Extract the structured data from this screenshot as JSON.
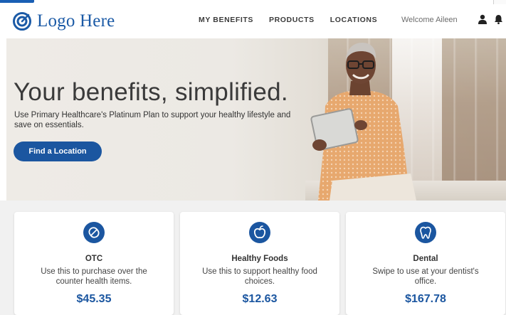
{
  "header": {
    "logo_text": "Logo Here",
    "nav": [
      {
        "label": "MY BENEFITS"
      },
      {
        "label": "PRODUCTS"
      },
      {
        "label": "LOCATIONS"
      }
    ],
    "welcome": "Welcome Aileen",
    "icons": {
      "logo": "logo-target-icon",
      "user": "user-icon",
      "notifications": "bell-icon"
    }
  },
  "hero": {
    "title": "Your benefits, simplified.",
    "subtitle": "Use Primary Healthcare's Platinum Plan to support your healthy lifestyle and save on essentials.",
    "cta_label": "Find a Location"
  },
  "cards": [
    {
      "icon": "pill-icon",
      "title": "OTC",
      "description": "Use this to purchase over the counter health items.",
      "amount": "$45.35"
    },
    {
      "icon": "apple-icon",
      "title": "Healthy Foods",
      "description": "Use this to support healthy food choices.",
      "amount": "$12.63"
    },
    {
      "icon": "tooth-icon",
      "title": "Dental",
      "description": "Swipe to use at your dentist's office.",
      "amount": "$167.78"
    }
  ],
  "colors": {
    "brand_blue": "#1b56a0",
    "logo_blue": "#1b5aa6",
    "card_bg": "#f1f1f1"
  }
}
